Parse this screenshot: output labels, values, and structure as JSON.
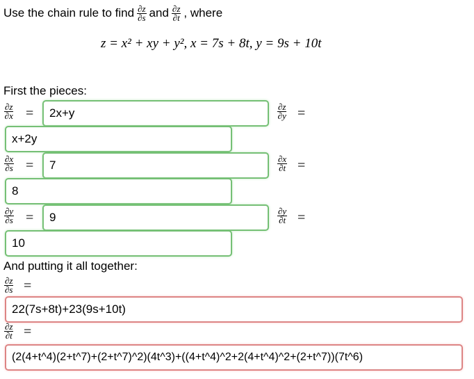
{
  "prompt": {
    "text_before": "Use the chain rule to find",
    "deriv1_num": "∂z",
    "deriv1_den": "∂s",
    "and": "and",
    "deriv2_num": "∂z",
    "deriv2_den": "∂t",
    "comma_where": ", where"
  },
  "equation": "z = x² + xy + y², x = 7s + 8t, y = 9s + 10t",
  "section_first": "First the pieces:",
  "pieces": {
    "dz_dx": {
      "num": "∂z",
      "den": "∂x",
      "value": "2x+y"
    },
    "dz_dy": {
      "num": "∂z",
      "den": "∂y",
      "value": "x+2y"
    },
    "dx_ds": {
      "num": "∂x",
      "den": "∂s",
      "value": "7"
    },
    "dx_dt": {
      "num": "∂x",
      "den": "∂t",
      "value": "8"
    },
    "dy_ds": {
      "num": "∂y",
      "den": "∂s",
      "value": "9"
    },
    "dy_dt": {
      "num": "∂y",
      "den": "∂t",
      "value": "10"
    }
  },
  "section_together": "And putting it all together:",
  "final": {
    "dz_ds": {
      "num": "∂z",
      "den": "∂s",
      "value": "22(7s+8t)+23(9s+10t)"
    },
    "dz_dt": {
      "num": "∂z",
      "den": "∂t",
      "value": "(2(4+t^4)(2+t^7)+(2+t^7)^2)(4t^3)+((4+t^4)^2+2(4+t^4)^2+(2+t^7))(7t^6)"
    }
  },
  "equals": "=",
  "colors": {
    "correct": "#6fbf6f",
    "incorrect": "#e08080"
  }
}
